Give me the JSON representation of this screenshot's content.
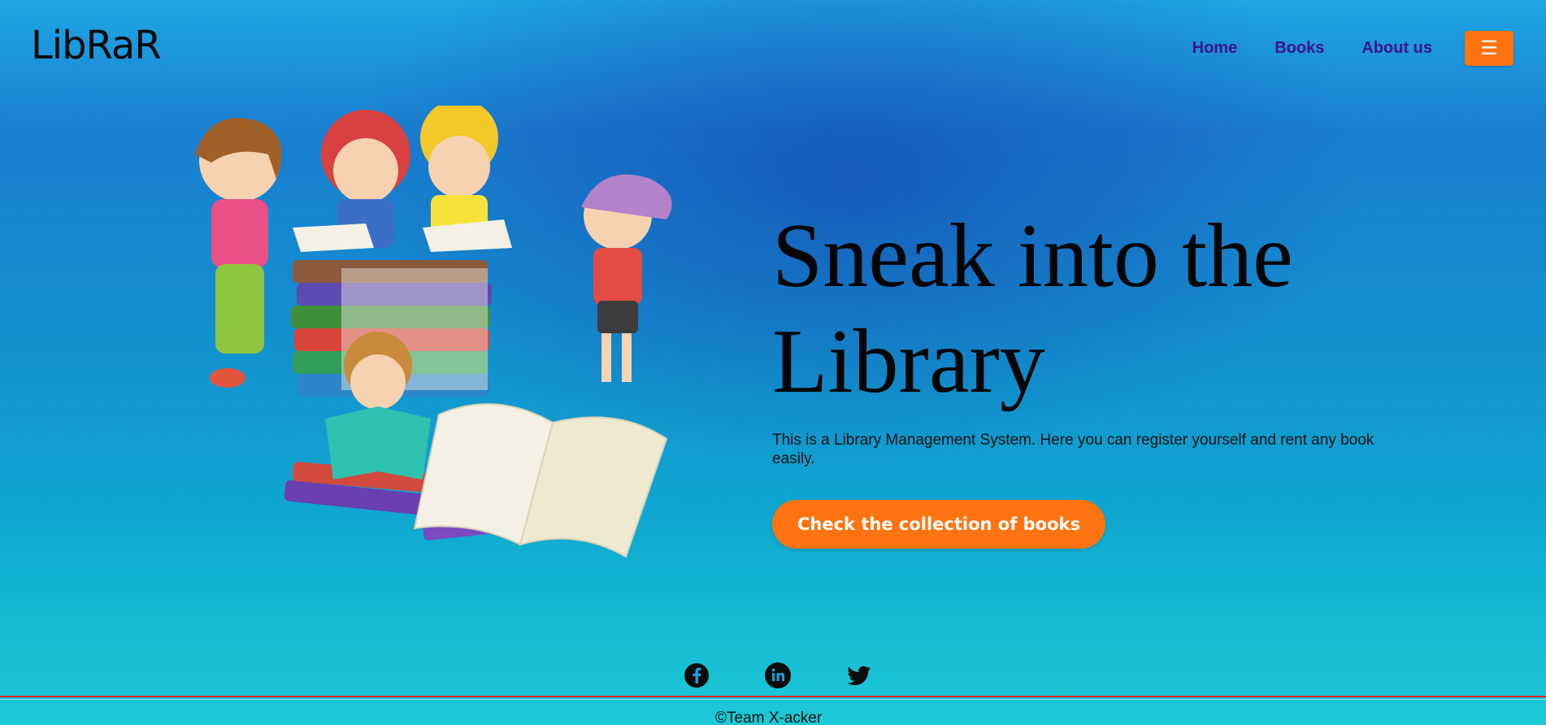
{
  "header": {
    "logo": "LibRaR",
    "nav": [
      {
        "label": "Home"
      },
      {
        "label": "Books"
      },
      {
        "label": "About us"
      }
    ],
    "menu_icon": "hamburger-icon",
    "menu_glyph": "☰"
  },
  "hero": {
    "title": "Sneak into the Library",
    "description": "This is a Library Management System. Here you can register yourself and rent any book easily.",
    "cta_label": "Check the collection of books",
    "illustration": "kids-reading-books-illustration"
  },
  "footer": {
    "socials": [
      {
        "icon": "facebook-icon"
      },
      {
        "icon": "linkedin-icon"
      },
      {
        "icon": "twitter-icon"
      }
    ],
    "copyright": "©Team X-acker"
  },
  "colors": {
    "accent": "#ff7410",
    "nav_link": "#3a1390",
    "divider": "#e32323"
  }
}
